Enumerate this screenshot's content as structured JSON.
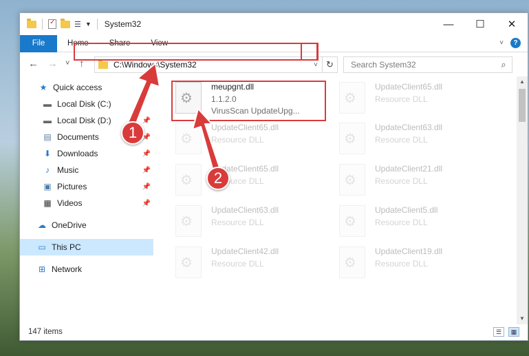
{
  "window": {
    "title": "System32"
  },
  "controls": {
    "minimize": "—",
    "maximize": "☐",
    "close": "✕"
  },
  "ribbon": {
    "file": "File",
    "tabs": [
      "Home",
      "Share",
      "View"
    ],
    "help": "?"
  },
  "nav": {
    "back": "←",
    "forward": "→",
    "recent": "˅",
    "up": "↑",
    "address": "C:\\Windows\\System32",
    "search_placeholder": "Search System32"
  },
  "sidebar": {
    "items": [
      {
        "label": "Quick access",
        "icon": "star-icon",
        "pinned": false
      },
      {
        "label": "Local Disk (C:)",
        "icon": "drive-icon",
        "pinned": false
      },
      {
        "label": "Local Disk (D:)",
        "icon": "drive-icon",
        "pinned": true
      },
      {
        "label": "Documents",
        "icon": "documents-icon",
        "pinned": true
      },
      {
        "label": "Downloads",
        "icon": "download-icon",
        "pinned": true
      },
      {
        "label": "Music",
        "icon": "music-icon",
        "pinned": true
      },
      {
        "label": "Pictures",
        "icon": "pictures-icon",
        "pinned": true
      },
      {
        "label": "Videos",
        "icon": "videos-icon",
        "pinned": true
      },
      {
        "label": "OneDrive",
        "icon": "cloud-icon",
        "pinned": false
      },
      {
        "label": "This PC",
        "icon": "pc-icon",
        "pinned": false,
        "selected": true
      },
      {
        "label": "Network",
        "icon": "network-icon",
        "pinned": false
      }
    ]
  },
  "files": [
    {
      "name": "meupgnt.dll",
      "version": "1.1.2.0",
      "desc": "VirusScan UpdateUpg...",
      "faded": false
    },
    {
      "name": "UpdateClient65.dll",
      "desc": "Resource DLL",
      "faded": true
    },
    {
      "name": "UpdateClient65.dll",
      "desc": "Resource DLL",
      "faded": true
    },
    {
      "name": "UpdateClient63.dll",
      "desc": "Resource DLL",
      "faded": true
    },
    {
      "name": "UpdateClient65.dll",
      "desc": "Resource DLL",
      "faded": true
    },
    {
      "name": "UpdateClient21.dll",
      "desc": "Resource DLL",
      "faded": true
    },
    {
      "name": "UpdateClient63.dll",
      "desc": "Resource DLL",
      "faded": true
    },
    {
      "name": "UpdateClient5.dll",
      "desc": "Resource DLL",
      "faded": true
    },
    {
      "name": "UpdateClient42.dll",
      "desc": "Resource DLL",
      "faded": true
    },
    {
      "name": "UpdateClient19.dll",
      "desc": "Resource DLL",
      "faded": true
    }
  ],
  "status": {
    "count": "147 items"
  },
  "callouts": {
    "step1": "1",
    "step2": "2"
  },
  "colors": {
    "accent": "#1979ca",
    "callout": "#d93b3b",
    "selected": "#cce8ff"
  }
}
